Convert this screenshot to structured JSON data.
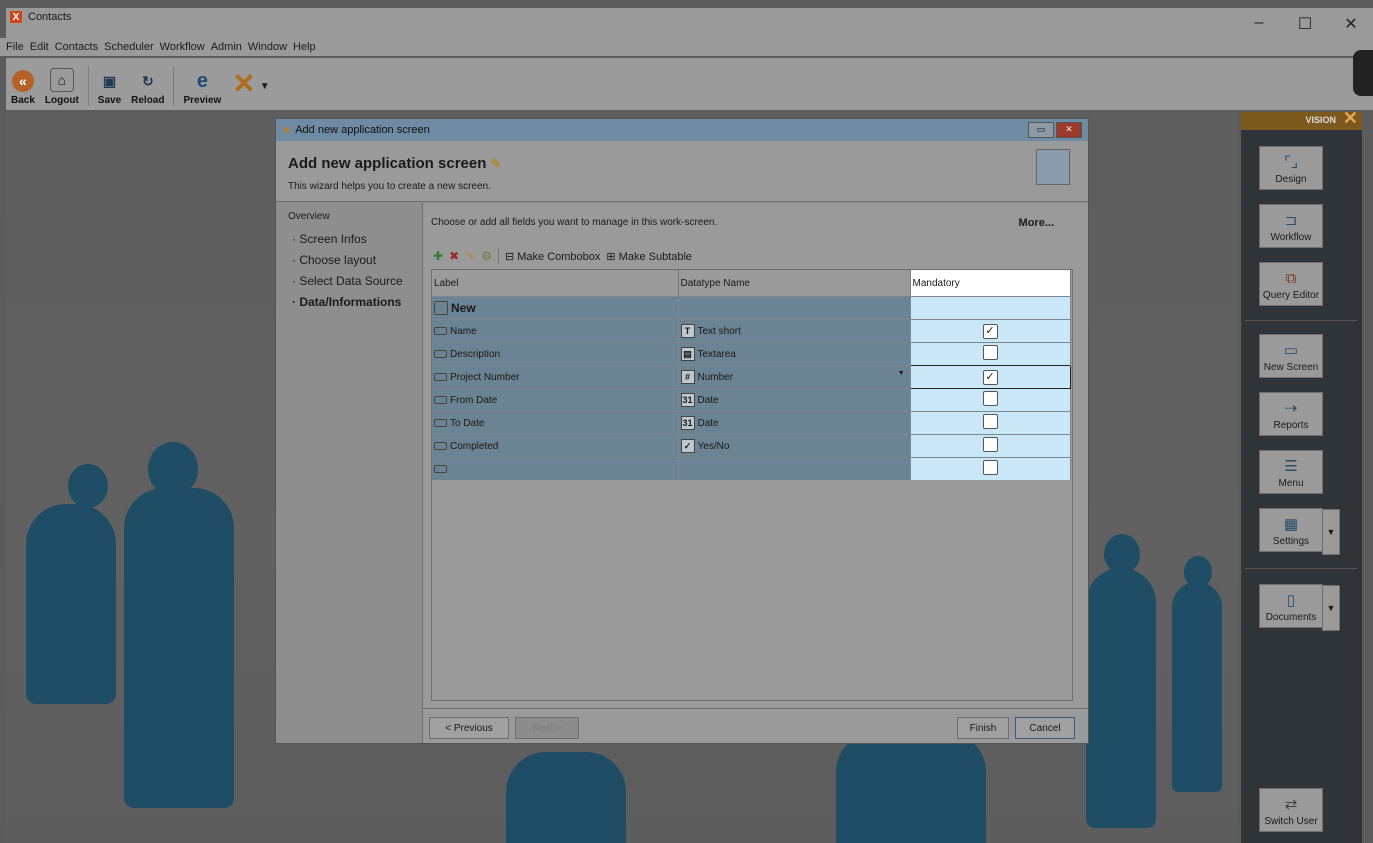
{
  "window": {
    "title": "Contacts",
    "app_icon_glyph": "X",
    "controls": [
      "–",
      "☐",
      "✕"
    ]
  },
  "menu": [
    "File",
    "Edit",
    "Contacts",
    "Scheduler",
    "Workflow",
    "Admin",
    "Window",
    "Help"
  ],
  "toolbar": {
    "back": "Back",
    "logout": "Logout",
    "save": "Save",
    "reload": "Reload",
    "preview": "Preview"
  },
  "vision": {
    "label": "VISION",
    "buttons": {
      "design": "Design",
      "workflow": "Workflow",
      "query_editor": "Query Editor",
      "new_screen": "New Screen",
      "reports": "Reports",
      "menu": "Menu",
      "settings": "Settings",
      "documents": "Documents",
      "switch_user": "Switch User"
    }
  },
  "dialog": {
    "title": "Add new application screen",
    "heading": "Add new application screen",
    "subtitle": "This wizard helps you to create a new screen.",
    "nav": {
      "overview": "Overview",
      "items": [
        "Screen Infos",
        "Choose layout",
        "Select Data Source",
        "Data/Informations"
      ],
      "active_index": 3
    },
    "description": "Choose or add all fields you want to manage in this work-screen.",
    "more": "More...",
    "toolbar": {
      "make_combobox": "Make Combobox",
      "make_subtable": "Make Subtable"
    },
    "grid": {
      "columns": [
        "Label",
        "Datatype Name",
        "Mandatory"
      ],
      "new_row_label": "New",
      "rows": [
        {
          "label": "Name",
          "type_icon": "T",
          "datatype": "Text short",
          "mandatory": "✓"
        },
        {
          "label": "Description",
          "type_icon": "▤",
          "datatype": "Textarea",
          "mandatory": ""
        },
        {
          "label": "Project Number",
          "type_icon": "#",
          "datatype": "Number",
          "mandatory": "✓"
        },
        {
          "label": "From Date",
          "type_icon": "31",
          "datatype": "Date",
          "mandatory": ""
        },
        {
          "label": "To Date",
          "type_icon": "31",
          "datatype": "Date",
          "mandatory": ""
        },
        {
          "label": "Completed",
          "type_icon": "✓",
          "datatype": "Yes/No",
          "mandatory": ""
        },
        {
          "label": "",
          "type_icon": "",
          "datatype": "",
          "mandatory": ""
        }
      ]
    },
    "footer": {
      "previous": "< Previous",
      "next": "Next >",
      "finish": "Finish",
      "cancel": "Cancel"
    }
  }
}
